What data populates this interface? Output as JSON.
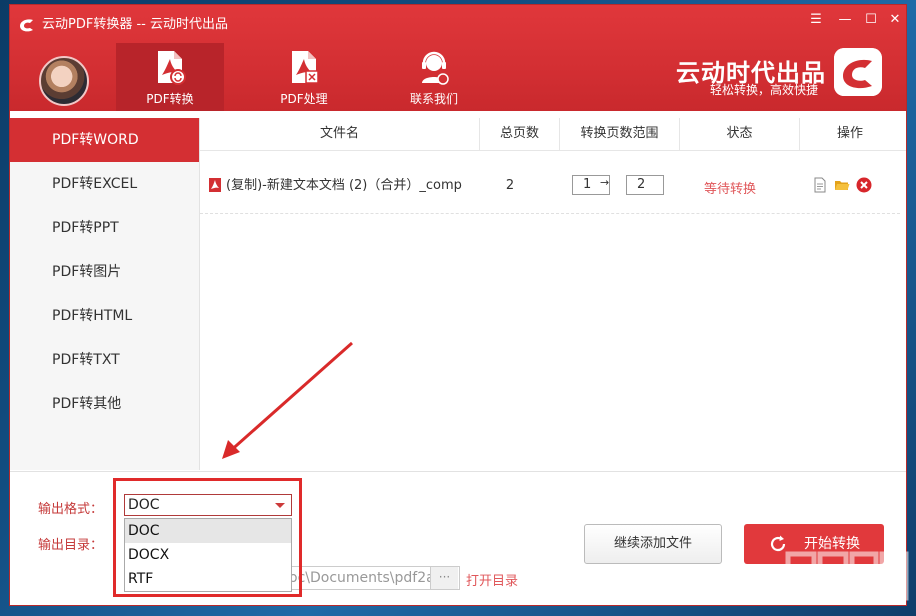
{
  "window": {
    "title": "云动PDF转换器 -- 云动时代出品",
    "controls": [
      "menu",
      "minimize",
      "maximize",
      "close"
    ]
  },
  "nav": {
    "tabs": [
      {
        "label": "PDF转换",
        "icon": "pdf-convert-icon",
        "active": true
      },
      {
        "label": "PDF处理",
        "icon": "pdf-process-icon",
        "active": false
      },
      {
        "label": "联系我们",
        "icon": "support-agent-icon",
        "active": false
      }
    ]
  },
  "brand": {
    "name": "云动时代出品",
    "slogan": "轻松转换，高效快捷"
  },
  "sidebar": {
    "items": [
      {
        "label": "PDF转WORD",
        "active": true
      },
      {
        "label": "PDF转EXCEL",
        "active": false
      },
      {
        "label": "PDF转PPT",
        "active": false
      },
      {
        "label": "PDF转图片",
        "active": false
      },
      {
        "label": "PDF转HTML",
        "active": false
      },
      {
        "label": "PDF转TXT",
        "active": false
      },
      {
        "label": "PDF转其他",
        "active": false
      }
    ]
  },
  "table": {
    "columns": [
      "文件名",
      "总页数",
      "转换页数范围",
      "状态",
      "操作"
    ],
    "rows": [
      {
        "file_name": "(复制)-新建文本文档 (2)（合并）_comp",
        "total_pages": "2",
        "range_from": "1",
        "range_to": "2",
        "status": "等待转换",
        "actions": [
          "view-file-icon",
          "open-folder-icon",
          "delete-icon"
        ]
      }
    ]
  },
  "output": {
    "format_label": "输出格式：",
    "format_value": "DOC",
    "format_options": [
      "DOC",
      "DOCX",
      "RTF"
    ],
    "dir_label": "输出目录：",
    "dir_value": "oc\\Documents\\pdf2a",
    "dir_more": "···",
    "open_dir": "打开目录"
  },
  "buttons": {
    "add_files": "继续添加文件",
    "start": "开始转换"
  },
  "colors": {
    "accent": "#d32f33",
    "status": "#e0575a"
  }
}
